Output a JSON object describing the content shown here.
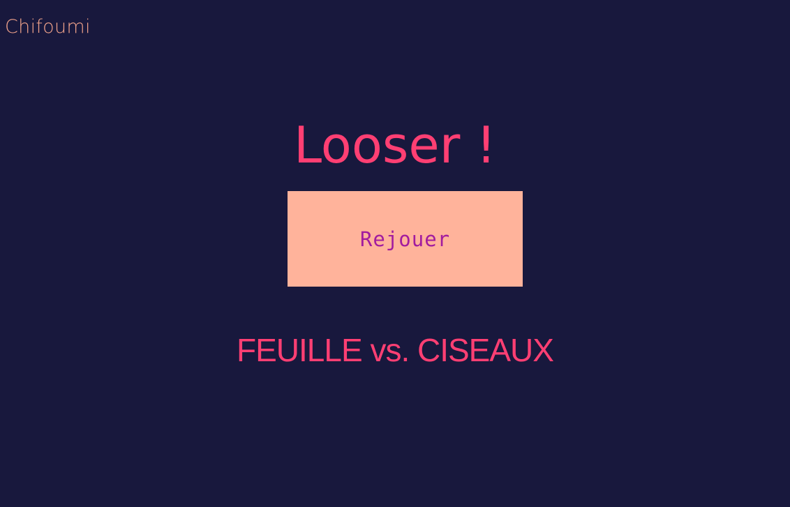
{
  "header": {
    "brand": "Chifoumi"
  },
  "game": {
    "result": "Looser !",
    "replay_label": "Rejouer",
    "matchup": "FEUILLE vs. CISEAUX"
  },
  "colors": {
    "background": "#18183d",
    "brand": "#f1a38b",
    "accent": "#ff3f73",
    "button_bg": "#ffb39b",
    "button_text": "#a21c9f"
  }
}
